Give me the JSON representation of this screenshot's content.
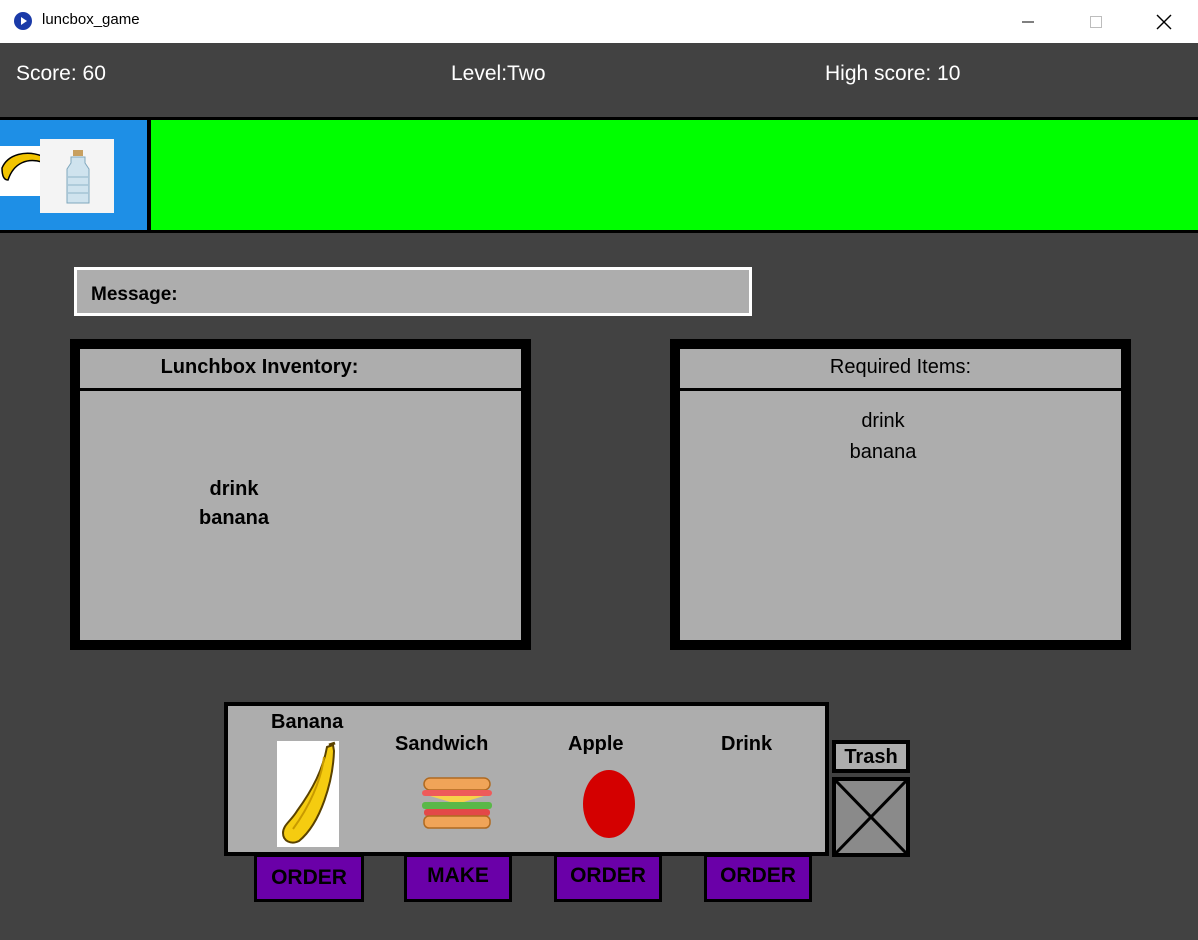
{
  "window": {
    "title": "luncbox_game",
    "icon": "app-icon"
  },
  "hud": {
    "score": "Score: 60",
    "level": "Level:Two",
    "high_score": "High score: 10"
  },
  "progress": {
    "slot_items": [
      "banana",
      "bottle"
    ],
    "bar_color": "#00ff00",
    "slot_color": "#1e8fe6"
  },
  "message": {
    "label": "Message:"
  },
  "inventory": {
    "title": "Lunchbox Inventory:",
    "items": [
      "drink",
      "banana"
    ]
  },
  "required": {
    "title": "Required Items:",
    "items": [
      "drink",
      "banana"
    ]
  },
  "shelf": {
    "items": [
      {
        "label": "Banana",
        "icon": "banana-icon"
      },
      {
        "label": "Sandwich",
        "icon": "sandwich-icon"
      },
      {
        "label": "Apple",
        "icon": "apple-icon"
      },
      {
        "label": "Drink",
        "icon": ""
      }
    ],
    "buttons": [
      "ORDER",
      "MAKE",
      "ORDER",
      "ORDER"
    ],
    "button_color": "#6a00a8"
  },
  "trash": {
    "label": "Trash"
  },
  "colors": {
    "background": "#424242",
    "panel": "#adadad",
    "apple": "#d40000"
  }
}
